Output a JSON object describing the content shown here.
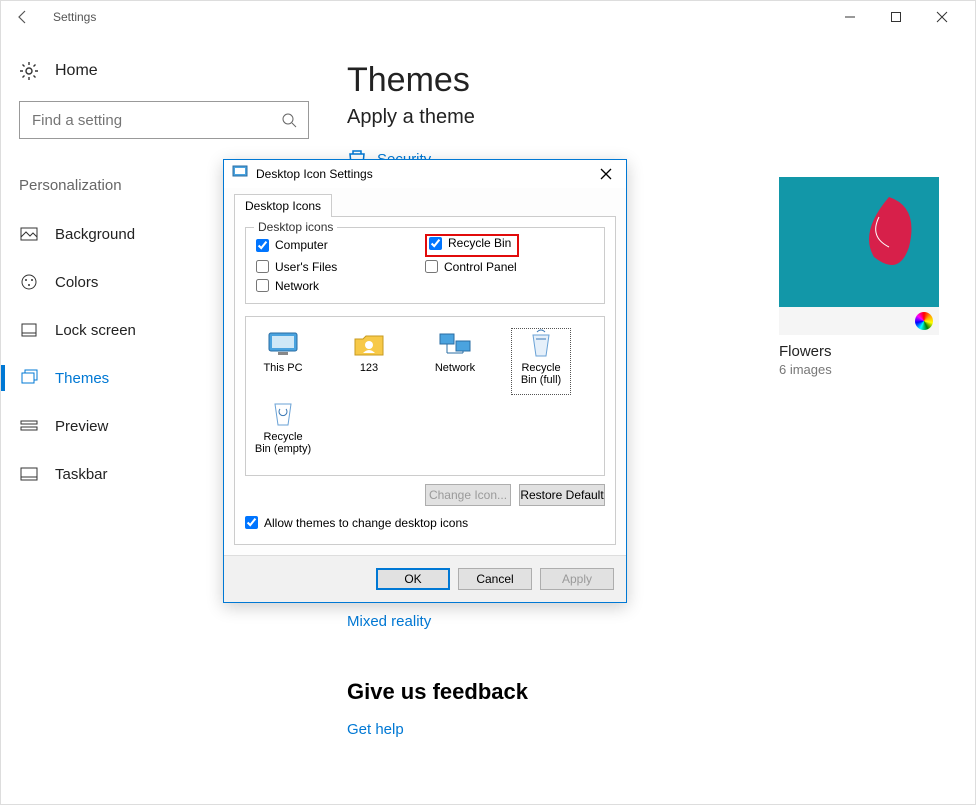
{
  "window": {
    "title": "Settings"
  },
  "sidebar": {
    "home": "Home",
    "search_placeholder": "Find a setting",
    "heading": "Personalization",
    "items": [
      {
        "label": "Background"
      },
      {
        "label": "Colors"
      },
      {
        "label": "Lock screen"
      },
      {
        "label": "Themes"
      },
      {
        "label": "Preview"
      },
      {
        "label": "Taskbar"
      }
    ]
  },
  "main": {
    "title": "Themes",
    "subtitle": "Apply a theme",
    "store_link": "Security",
    "themes": [
      {
        "name": "",
        "sub": ""
      },
      {
        "name": "Flowers",
        "sub": "6 images"
      }
    ],
    "mixed_reality": "Mixed reality",
    "feedback_heading": "Give us feedback",
    "get_help": "Get help"
  },
  "dialog": {
    "title": "Desktop Icon Settings",
    "tab": "Desktop Icons",
    "fieldset_legend": "Desktop icons",
    "chks": {
      "computer": "Computer",
      "users_files": "User's Files",
      "network": "Network",
      "recycle_bin": "Recycle Bin",
      "control_panel": "Control Panel"
    },
    "icons": [
      {
        "label": "This PC"
      },
      {
        "label": "123"
      },
      {
        "label": "Network"
      },
      {
        "label": "Recycle Bin (full)"
      },
      {
        "label": "Recycle Bin (empty)"
      }
    ],
    "change_icon": "Change Icon...",
    "restore_default": "Restore Default",
    "allow_label": "Allow themes to change desktop icons",
    "ok": "OK",
    "cancel": "Cancel",
    "apply": "Apply"
  }
}
